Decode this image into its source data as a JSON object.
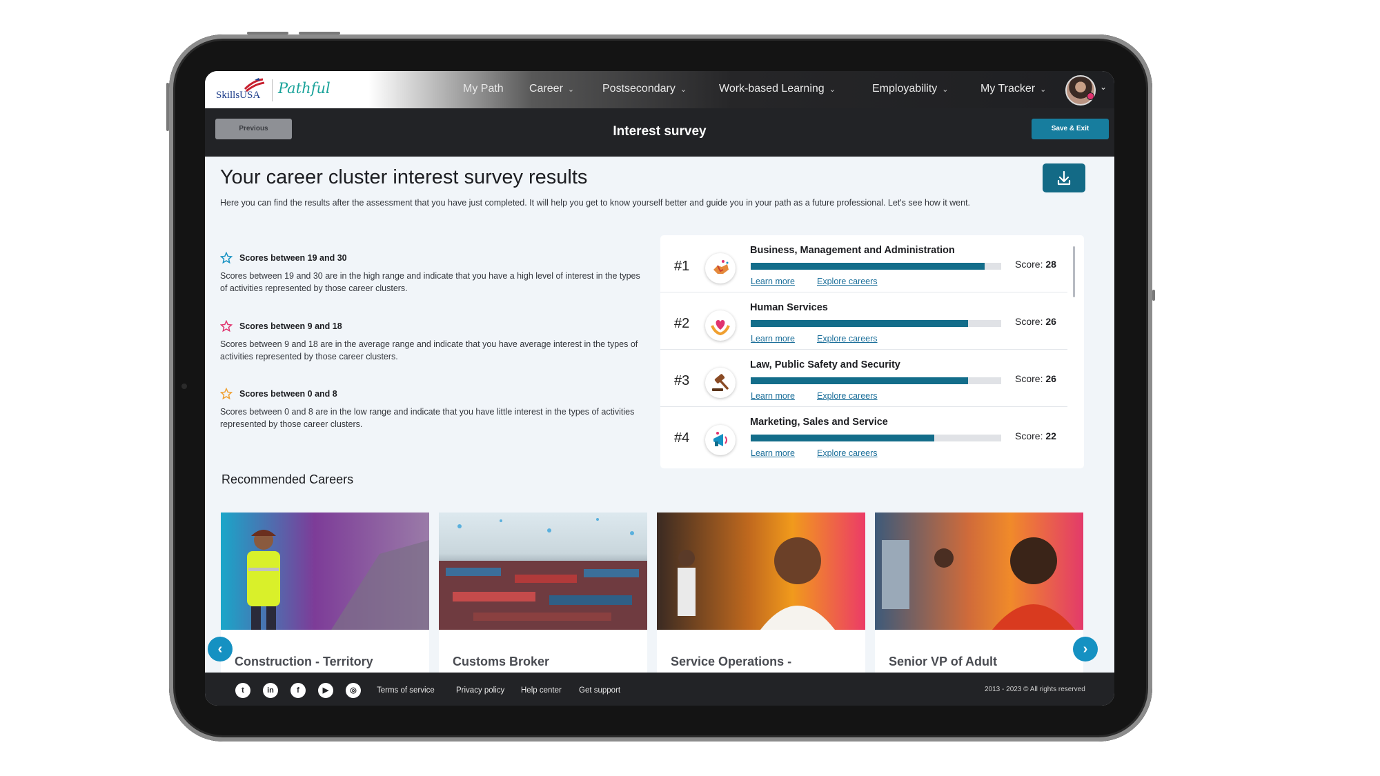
{
  "header": {
    "brand_skillsusa": "SkillsUSA",
    "brand_pathful": "Pathful",
    "nav": [
      "My Path",
      "Career",
      "Postsecondary",
      "Work-based Learning",
      "Employability",
      "My Tracker"
    ],
    "nav_dropdown": [
      false,
      true,
      true,
      true,
      true,
      true
    ]
  },
  "subheader": {
    "previous_label": "Previous",
    "title": "Interest survey",
    "save_label": "Save & Exit"
  },
  "results": {
    "title": "Your career cluster interest survey results",
    "intro": "Here you can find the results after the assessment that you have just completed. It will help you get to know yourself better and guide you in your path as a future professional. Let's see how it went.",
    "legend": [
      {
        "title": "Scores between 19 and 30",
        "desc": "Scores between 19 and 30 are in the high range and indicate that you have a high level of interest in the types of activities represented by those career clusters.",
        "star_color": "#1591c2"
      },
      {
        "title": "Scores between 9 and 18",
        "desc": "Scores between 9 and 18 are in the average range and indicate that you have average interest in the types of activities represented by those career clusters.",
        "star_color": "#e0336e"
      },
      {
        "title": "Scores between 0 and 8",
        "desc": "Scores between 0 and 8 are in the low range and indicate that you have little interest in the types of activities represented by those career clusters.",
        "star_color": "#f0a030"
      }
    ],
    "score_prefix": "Score:",
    "learn_more": "Learn more",
    "explore_careers": "Explore careers",
    "clusters": [
      {
        "rank": "#1",
        "name": "Business, Management and Administration",
        "score": 28,
        "icon": "handshake-icon"
      },
      {
        "rank": "#2",
        "name": "Human Services",
        "score": 26,
        "icon": "heart-hands-icon"
      },
      {
        "rank": "#3",
        "name": "Law, Public Safety and Security",
        "score": 26,
        "icon": "gavel-icon"
      },
      {
        "rank": "#4",
        "name": "Marketing, Sales and Service",
        "score": 22,
        "icon": "megaphone-icon"
      }
    ],
    "score_max": 30
  },
  "recommended": {
    "title": "Recommended Careers",
    "cards": [
      {
        "title": "Construction - Territory"
      },
      {
        "title": "Customs Broker"
      },
      {
        "title": "Service Operations -"
      },
      {
        "title": "Senior VP of Adult"
      }
    ]
  },
  "footer": {
    "social": [
      "twitter-icon",
      "linkedin-icon",
      "facebook-icon",
      "youtube-icon",
      "instagram-icon"
    ],
    "links": [
      "Terms of service",
      "Privacy policy",
      "Help center",
      "Get support"
    ],
    "copyright": "2013 - 2023 © All rights reserved"
  },
  "colors": {
    "accent": "#136d8a",
    "arrow": "#1591c2",
    "dark": "#222326"
  }
}
